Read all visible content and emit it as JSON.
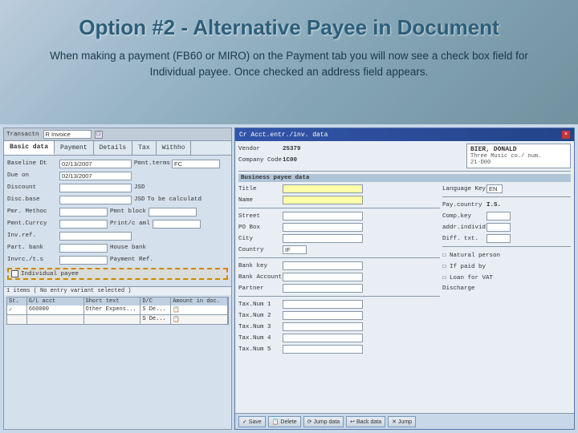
{
  "header": {
    "title": "Option #2 - Alternative Payee in Document",
    "subtitle": "When making a payment (FB60 or MIRO) on the Payment tab you will now see a check box field for Individual payee. Once checked an address field appears."
  },
  "left_panel": {
    "toolbar_text": "Transactn",
    "toolbar_value": "R Invoice",
    "tabs": [
      {
        "label": "Basic data",
        "active": true
      },
      {
        "label": "Payment",
        "active": false
      },
      {
        "label": "Details",
        "active": false
      },
      {
        "label": "Tax",
        "active": false
      },
      {
        "label": "Withho",
        "active": false
      }
    ],
    "form_rows": [
      {
        "label": "Baseline Dt",
        "value": "02/13/2007"
      },
      {
        "label": "Due on",
        "value": "02/13/2007"
      },
      {
        "label": "Discount",
        "suffix": "JSD"
      },
      {
        "label": "Disc.base",
        "suffix": "JSD",
        "note": "To be calculatd"
      },
      {
        "label": "Pmr. Methoc",
        "right_label": "Pmnt block"
      },
      {
        "label": "Pmnt.Currcy",
        "right_label": "Print/c aml"
      },
      {
        "label": "Inv.ref."
      },
      {
        "label": "Part. bank",
        "right_value": "House bank"
      },
      {
        "label": "Invrc./t.s",
        "right_value": "Payment Ref."
      }
    ],
    "individual_payee_label": "Individual payee",
    "items_bar": "1 items ( No entry variant selected )",
    "table": {
      "headers": [
        "St.",
        "G/L acct",
        "Short text",
        "D/C",
        "Amount in doc."
      ],
      "rows": [
        {
          "status": "✓",
          "gl": "660000",
          "short": "Other Expens...",
          "dc": "S De...",
          "amount": "",
          "icon": "📋"
        },
        {
          "status": "",
          "gl": "",
          "short": "",
          "dc": "S De...",
          "amount": "",
          "icon": "📋"
        }
      ]
    }
  },
  "right_panel": {
    "title": "Cr Acct.entr./inv. data",
    "vendor_num": "25379",
    "vendor_name": "BIER, DONALD",
    "company_code": "1C00",
    "company_name": "Three Music co./ num.",
    "wbl": "21-D00",
    "dialog_section": "Business payee data",
    "title_field": "",
    "name_field": "",
    "language_key": "EN",
    "fields": {
      "street": "",
      "po_box": "",
      "city": "",
      "country": "IF",
      "bank_key": "",
      "bank_account": "",
      "partner": "",
      "tax_num1": "",
      "tax_num2": "",
      "tax_num3": "",
      "tax_num4": "",
      "tax_num5": ""
    },
    "right_fields": {
      "pay_country": "I.S.",
      "comp_key": "",
      "addr_indiv": "",
      "diff_txt": "",
      "natural_person": "☐ Natural person",
      "if_paid_by": "☐ If paid by",
      "loan_for_vat": "☐ Loan for VAT",
      "discharge": "Discharge"
    },
    "buttons": [
      "✓ Save",
      "📋 Delete",
      "⟳ Jump data",
      "↩ Back data",
      "✕ Jump"
    ]
  }
}
